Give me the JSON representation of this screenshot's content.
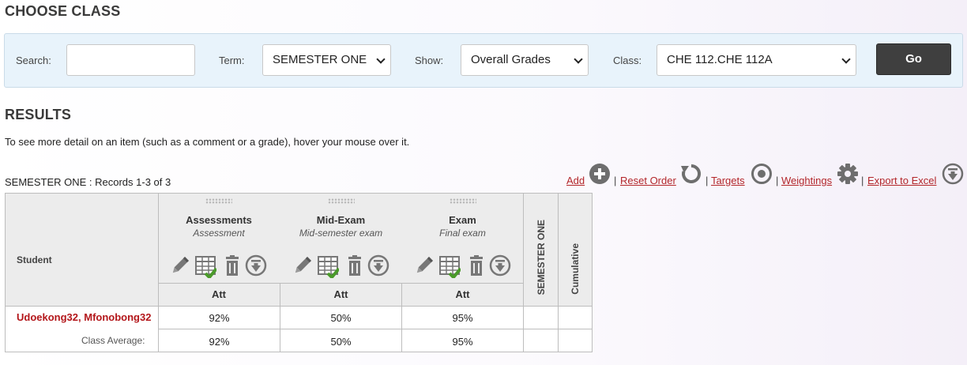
{
  "choose_class": {
    "title": "CHOOSE CLASS"
  },
  "filters": {
    "search_label": "Search:",
    "search_value": "",
    "term_label": "Term:",
    "term_value": "SEMESTER ONE",
    "show_label": "Show:",
    "show_value": "Overall Grades",
    "class_label": "Class:",
    "class_value": "CHE 112.CHE 112A",
    "go_label": "Go"
  },
  "results": {
    "title": "RESULTS",
    "hint": "To see more detail on an item (such as a comment or a grade), hover your mouse over it.",
    "records": "SEMESTER ONE : Records 1-3 of 3"
  },
  "actions": {
    "add": "Add",
    "reset_order": "Reset Order",
    "targets": "Targets",
    "weightings": "Weightings",
    "export": "Export to Excel",
    "separator": "|"
  },
  "table": {
    "student_header": "Student",
    "columns": [
      {
        "name": "Assessments",
        "subtitle": "Assessment",
        "att": "Att"
      },
      {
        "name": "Mid-Exam",
        "subtitle": "Mid-semester exam",
        "att": "Att"
      },
      {
        "name": "Exam",
        "subtitle": "Final exam",
        "att": "Att"
      }
    ],
    "semester_header": "SEMESTER ONE",
    "cumulative_header": "Cumulative",
    "rows": [
      {
        "student": "Udoekong32, Mfonobong32",
        "values": [
          "92%",
          "50%",
          "95%"
        ],
        "semester": "",
        "cumulative": ""
      }
    ],
    "class_average": {
      "label": "Class Average:",
      "values": [
        "92%",
        "50%",
        "95%"
      ]
    }
  },
  "icons": {
    "add": "plus-circle-icon",
    "reset": "refresh-icon",
    "targets": "target-icon",
    "weightings": "gear-icon",
    "export": "download-circle-icon",
    "edit": "pencil-icon",
    "grid": "grid-check-icon",
    "delete": "trash-icon",
    "download": "download-circle-icon"
  },
  "colors": {
    "link": "#b3262a",
    "student": "#b3161a",
    "go_button": "#3f3f3f",
    "filter_bg": "#e8f3fb"
  }
}
